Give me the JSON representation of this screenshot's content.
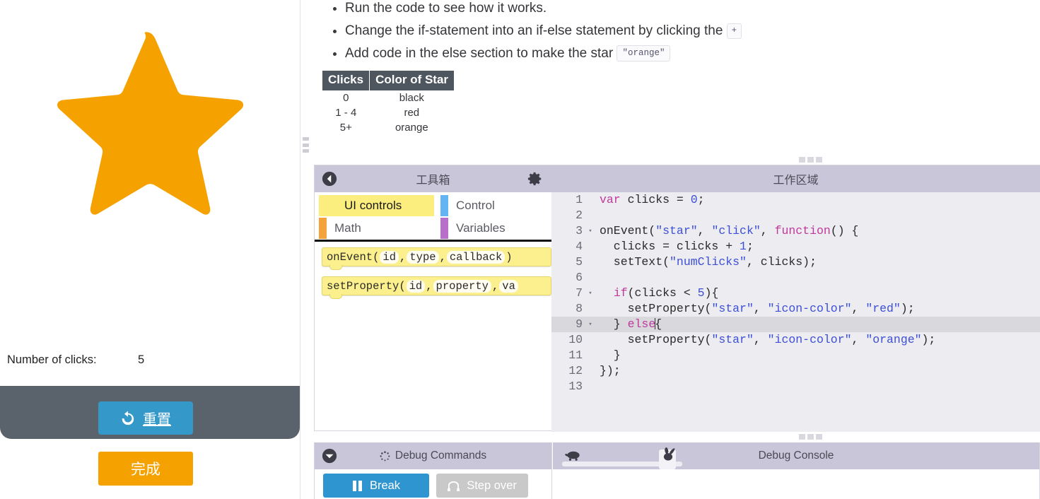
{
  "colors": {
    "star": "#f5a201",
    "reset_button": "#3498c8",
    "finish_button": "#f5a201",
    "panel_header": "#c9c6da",
    "table_header": "#4e565f",
    "block_yellow": "#fbf08d",
    "cat_control": "#62b4f2",
    "cat_math": "#f2a33c",
    "cat_variables": "#b86fcb",
    "break_button": "#2f95d1",
    "step_over_button": "#c9c9c9",
    "active_line": "#d8d8dd"
  },
  "app_panel": {
    "star_icon_name": "star-icon",
    "clicks_label": "Number of clicks:",
    "clicks_value": "5",
    "reset_label": "重置",
    "reset_icon": "refresh-icon",
    "finish_label": "完成"
  },
  "instructions": {
    "bullets": [
      {
        "before": "Run the code to see how it works.",
        "code": "",
        "after": ""
      },
      {
        "before": "Change the if-statement into an if-else statement by clicking the",
        "code": "+",
        "after": ""
      },
      {
        "before": "Add code in the else section to make the star",
        "code": "\"orange\"",
        "after": ""
      }
    ],
    "table": {
      "headers": [
        "Clicks",
        "Color of Star"
      ],
      "rows": [
        [
          "0",
          "black"
        ],
        [
          "1 - 4",
          "red"
        ],
        [
          "5+",
          "orange"
        ]
      ]
    }
  },
  "toolbox": {
    "title": "工具箱",
    "back_icon": "back-arrow-icon",
    "gear_icon": "gear-icon",
    "categories": [
      {
        "label": "UI controls",
        "selected": true
      },
      {
        "label": "Control",
        "selected": false
      },
      {
        "label": "Math",
        "selected": false
      },
      {
        "label": "Variables",
        "selected": false
      }
    ],
    "blocks": [
      {
        "name": "onEvent",
        "parts": [
          "onEvent(",
          "id",
          ", ",
          "type",
          ", ",
          "callback",
          ")"
        ]
      },
      {
        "name": "setProperty",
        "parts": [
          "setProperty(",
          "id",
          ", ",
          "property",
          ", ",
          "va",
          ""
        ]
      }
    ]
  },
  "workspace": {
    "title": "工作区域",
    "lines": [
      {
        "n": "1",
        "fold": "",
        "code": "var clicks = 0;",
        "active": false
      },
      {
        "n": "2",
        "fold": "",
        "code": "",
        "active": false
      },
      {
        "n": "3",
        "fold": "▾",
        "code": "onEvent(\"star\", \"click\", function() {",
        "active": false
      },
      {
        "n": "4",
        "fold": "",
        "code": "  clicks = clicks + 1;",
        "active": false
      },
      {
        "n": "5",
        "fold": "",
        "code": "  setText(\"numClicks\", clicks);",
        "active": false
      },
      {
        "n": "6",
        "fold": "",
        "code": "",
        "active": false
      },
      {
        "n": "7",
        "fold": "▾",
        "code": "  if(clicks < 5){",
        "active": false
      },
      {
        "n": "8",
        "fold": "",
        "code": "    setProperty(\"star\", \"icon-color\", \"red\");",
        "active": false
      },
      {
        "n": "9",
        "fold": "▾",
        "code": "  } else{",
        "active": true
      },
      {
        "n": "10",
        "fold": "",
        "code": "    setProperty(\"star\", \"icon-color\", \"orange\");",
        "active": false
      },
      {
        "n": "11",
        "fold": "",
        "code": "  }",
        "active": false
      },
      {
        "n": "12",
        "fold": "",
        "code": "});",
        "active": false
      },
      {
        "n": "13",
        "fold": "",
        "code": "",
        "active": false
      }
    ]
  },
  "debug": {
    "commands_title": "Debug Commands",
    "chevron_icon": "chevron-down-icon",
    "spinner_icon": "spinner-icon",
    "break_label": "Break",
    "break_icon": "pause-icon",
    "step_over_label": "Step over",
    "step_over_icon": "step-over-icon",
    "console_title": "Debug Console",
    "slider_slow_icon": "turtle-icon",
    "slider_fast_icon": "rabbit-icon"
  }
}
